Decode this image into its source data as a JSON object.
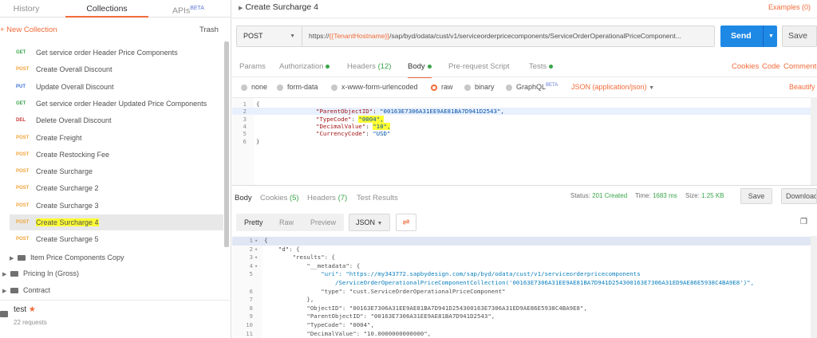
{
  "sidebar": {
    "tabs": [
      {
        "label": "History"
      },
      {
        "label": "Collections"
      },
      {
        "label": "APIs",
        "badge": "BETA"
      }
    ],
    "new_collection": "+ New Collection",
    "trash": "Trash",
    "requests": [
      {
        "method": "GET",
        "name": "Get service order Header Price Components"
      },
      {
        "method": "POST",
        "name": "Create Overall Discount"
      },
      {
        "method": "PUT",
        "name": "Update Overall Discount"
      },
      {
        "method": "GET",
        "name": "Get service order Header Updated Price Components"
      },
      {
        "method": "DEL",
        "name": "Delete Overall Discount"
      },
      {
        "method": "POST",
        "name": "Create Freight"
      },
      {
        "method": "POST",
        "name": "Create Restocking Fee"
      },
      {
        "method": "POST",
        "name": "Create Surcharge"
      },
      {
        "method": "POST",
        "name": "Create Surcharge 2"
      },
      {
        "method": "POST",
        "name": "Create Surcharge 3"
      },
      {
        "method": "POST",
        "name": "Create Surcharge 4",
        "selected": true
      },
      {
        "method": "POST",
        "name": "Create Surcharge 5"
      }
    ],
    "folders": [
      {
        "name": "Item Price Components Copy"
      },
      {
        "name": "Pricing In (Gross)"
      },
      {
        "name": "Contract"
      }
    ],
    "collection": {
      "name": "test",
      "count": "22 requests"
    }
  },
  "main": {
    "title": "Create Surcharge 4",
    "examples": "Examples (0)",
    "method": "POST",
    "url_prefix": "https://",
    "url_var": "{{TenantHostname}}",
    "url_rest": "/sap/byd/odata/cust/v1/serviceorderpricecomponents/ServiceOrderOperationalPriceComponent...",
    "send": "Send",
    "save": "Save",
    "req_tabs": [
      {
        "label": "Params"
      },
      {
        "label": "Authorization"
      },
      {
        "label": "Headers",
        "count": "(12)"
      },
      {
        "label": "Body"
      },
      {
        "label": "Pre-request Script"
      },
      {
        "label": "Tests"
      }
    ],
    "right_links": [
      "Cookies",
      "Code",
      "Comments"
    ],
    "body_types": [
      "none",
      "form-data",
      "x-www-form-urlencoded",
      "raw",
      "binary",
      "GraphQL"
    ],
    "graphql_badge": "BETA",
    "content_type": "JSON (application/json)",
    "beautify": "Beautify",
    "body_lines": [
      {
        "n": "1",
        "t": "{"
      },
      {
        "n": "2",
        "k": "\"ParentObjectID\"",
        "v": "\"00163E7306A31EE9AE81BA7D941D2543\","
      },
      {
        "n": "3",
        "k": "\"TypeCode\"",
        "v": "\"0004\","
      },
      {
        "n": "4",
        "k": "\"DecimalValue\"",
        "v": "\"10\","
      },
      {
        "n": "5",
        "k": "\"CurrencyCode\"",
        "v": "\"USD\""
      },
      {
        "n": "6",
        "t": "}"
      }
    ],
    "resp_tabs": [
      {
        "label": "Body"
      },
      {
        "label": "Cookies",
        "count": "(5)"
      },
      {
        "label": "Headers",
        "count": "(7)"
      },
      {
        "label": "Test Results"
      }
    ],
    "status_label": "Status:",
    "status": "201 Created",
    "time_label": "Time:",
    "time": "1683 ms",
    "size_label": "Size:",
    "size": "1.25 KB",
    "resp_save": "Save",
    "resp_download": "Download",
    "formats": [
      "Pretty",
      "Raw",
      "Preview"
    ],
    "format_type": "JSON",
    "resp_lines": [
      {
        "n": "1",
        "t": "{"
      },
      {
        "n": "2",
        "t": "    \"d\": {"
      },
      {
        "n": "3",
        "t": "        \"results\": {"
      },
      {
        "n": "4",
        "t": "            \"__metadata\": {"
      },
      {
        "n": "5",
        "t": "                \"uri\": \"https://my343772.sapbydesign.com/sap/byd/odata/cust/v1/serviceorderpricecomponents"
      },
      {
        "n": "",
        "t": "                    /ServiceOrderOperationalPriceComponentCollection('00163E7306A31EE9AE81BA7D941D254300163E7306A31ED9AE86E5938C4BA9E8')\","
      },
      {
        "n": "6",
        "t": "                \"type\": \"cust.ServiceOrderOperationalPriceComponent\""
      },
      {
        "n": "7",
        "t": "            },"
      },
      {
        "n": "8",
        "t": "            \"ObjectID\": \"00163E7306A31EE9AE81BA7D941D254300163E7306A31ED9AE86E5938C4BA9E8\","
      },
      {
        "n": "9",
        "t": "            \"ParentObjectID\": \"00163E7306A31EE9AE81BA7D941D2543\","
      },
      {
        "n": "10",
        "t": "            \"TypeCode\": \"0004\","
      },
      {
        "n": "11",
        "t": "            \"DecimalValue\": \"10.0000000000000\","
      }
    ]
  }
}
